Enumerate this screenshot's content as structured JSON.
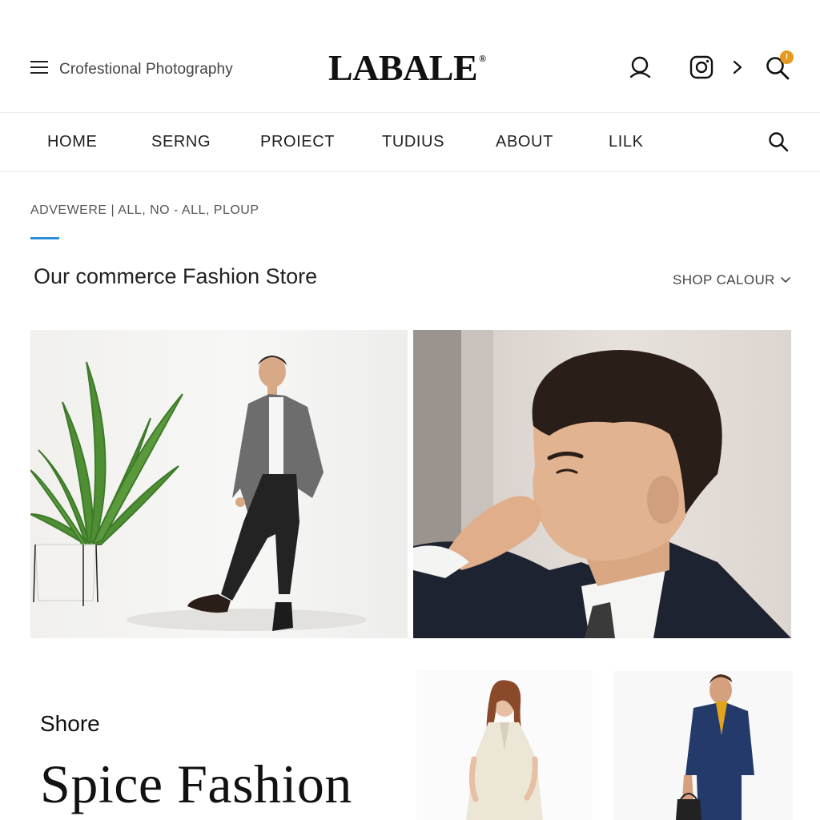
{
  "header": {
    "tagline": "Crofestional Photography",
    "logo": "LABALE",
    "logo_mark": "®",
    "cart_badge": "!",
    "icons": [
      "menu-icon",
      "user-search-icon",
      "instagram-icon",
      "chevron-right-icon",
      "search-icon"
    ]
  },
  "nav": {
    "items": [
      "HOME",
      "SERNG",
      "PROIECT",
      "TUDIUS",
      "ABOUT",
      "LILK"
    ],
    "search_icon": "search-icon"
  },
  "breadcrumb": "ADVEWERE | ALL, NO - ALL, PLOUP",
  "page": {
    "title": "Our commerce Fashion Store",
    "sort_label": "SHOP CALOUR"
  },
  "promo": {
    "label": "Shore",
    "headline": "Spice Fashion"
  },
  "colors": {
    "accent": "#2a8fd8",
    "badge": "#e59a1d",
    "text": "#1a1a1a"
  }
}
